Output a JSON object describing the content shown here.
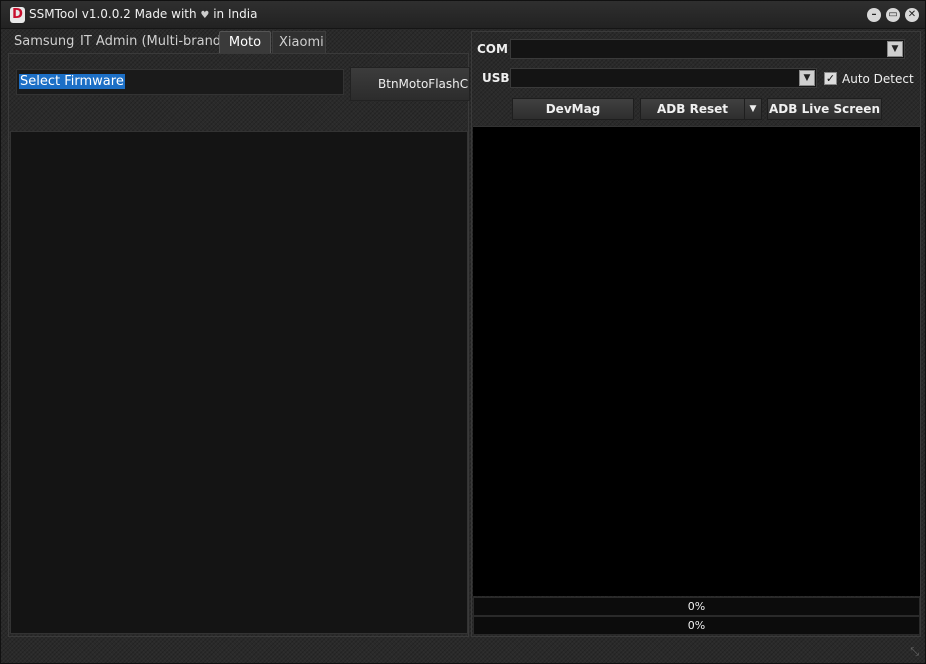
{
  "window": {
    "logo_letter": "D",
    "title_prefix": "SSMTool v1.0.0.2 Made with",
    "heart_icon": "♥",
    "title_suffix": "in India"
  },
  "tabs": [
    {
      "label": "Samsung"
    },
    {
      "label": "IT Admin (Multi-brand)"
    },
    {
      "label": "Moto"
    },
    {
      "label": "Xiaomi"
    }
  ],
  "active_tab": "Moto",
  "left": {
    "firmware_input_value": "Select Firmware",
    "flash_button_label": "BtnMotoFlashCl"
  },
  "right": {
    "com_label": "COM",
    "com_value": "",
    "usb_label": "USB",
    "usb_value": "",
    "auto_detect_label": "Auto Detect",
    "auto_detect_checked": true,
    "devmag_label": "DevMag",
    "adb_reset_label": "ADB Reset",
    "adb_live_label": "ADB Live Screen",
    "progress1": "0%",
    "progress2": "0%"
  }
}
